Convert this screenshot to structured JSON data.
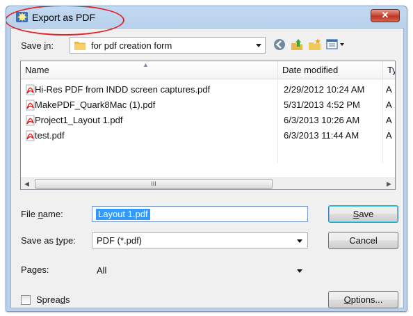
{
  "window": {
    "title": "Export as PDF",
    "close_glyph": "✕"
  },
  "toolbar": {
    "save_in_label_pre": "Save ",
    "save_in_label_key": "i",
    "save_in_label_post": "n:",
    "folder": "for pdf creation form",
    "icons": [
      "back-icon",
      "up-folder-icon",
      "new-folder-icon",
      "view-menu-icon"
    ]
  },
  "file_list": {
    "columns": {
      "name": "Name",
      "date": "Date modified",
      "type": "Ty"
    },
    "files": [
      {
        "name": "Hi-Res PDF from INDD screen captures.pdf",
        "date": "2/29/2012 10:24 AM",
        "type": "A"
      },
      {
        "name": "MakePDF_Quark8Mac (1).pdf",
        "date": "5/31/2013 4:52 PM",
        "type": "A"
      },
      {
        "name": "Project1_Layout 1.pdf",
        "date": "6/3/2013 10:26 AM",
        "type": "A"
      },
      {
        "name": "test.pdf",
        "date": "6/3/2013 11:44 AM",
        "type": "A"
      }
    ],
    "scroll_grip": "III"
  },
  "form": {
    "file_name_label_pre": "File ",
    "file_name_label_key": "n",
    "file_name_label_post": "ame:",
    "file_name_value": "Layout 1.pdf",
    "save_type_label_pre": "Save as ",
    "save_type_label_key": "t",
    "save_type_label_post": "ype:",
    "save_type_value": "PDF (*.pdf)",
    "pages_label_pre": "Pa",
    "pages_label_key": "g",
    "pages_label_post": "es:",
    "pages_value": "All",
    "spreads_label_pre": "Sprea",
    "spreads_label_key": "d",
    "spreads_label_post": "s",
    "spreads_checked": false
  },
  "buttons": {
    "save_key": "S",
    "save_rest": "ave",
    "cancel": "Cancel",
    "options_key": "O",
    "options_rest": "ptions..."
  },
  "colors": {
    "title_bar": "#c3d9f1",
    "highlight": "#3399ff",
    "annotation": "#e2242b"
  }
}
